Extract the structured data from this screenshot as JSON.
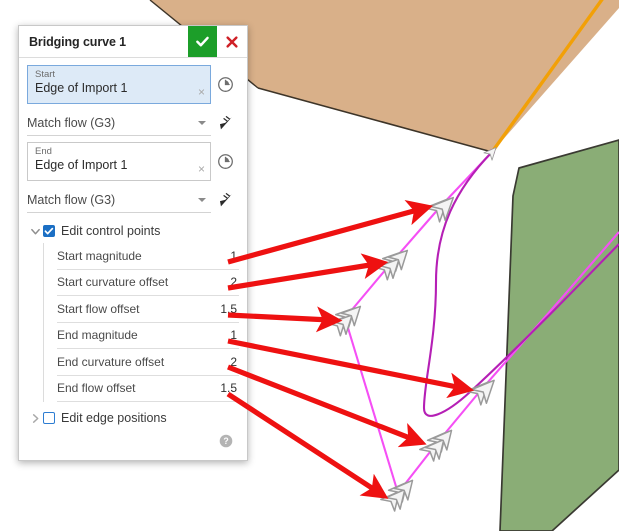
{
  "panel": {
    "title": "Bridging curve 1",
    "confirm_icon": "check-icon",
    "cancel_icon": "close-icon",
    "start": {
      "label": "Start",
      "value": "Edge of Import 1",
      "clear_icon": "×",
      "history_icon": "clock-icon",
      "continuity": "Match flow (G3)",
      "flow_icon": "flow-direction-arrow-icon"
    },
    "end": {
      "label": "End",
      "value": "Edge of Import 1",
      "clear_icon": "×",
      "history_icon": "clock-icon",
      "continuity": "Match flow (G3)",
      "flow_icon": "flow-direction-arrow-icon"
    },
    "edit_control_points": {
      "label": "Edit control points",
      "checked": true,
      "expanded": true,
      "chevron": "∨",
      "parameters": [
        {
          "name": "Start magnitude",
          "value": "1"
        },
        {
          "name": "Start curvature offset",
          "value": "2"
        },
        {
          "name": "Start flow offset",
          "value": "1.5"
        },
        {
          "name": "End magnitude",
          "value": "1"
        },
        {
          "name": "End curvature offset",
          "value": "2"
        },
        {
          "name": "End flow offset",
          "value": "1.5"
        }
      ]
    },
    "edit_edge_positions": {
      "label": "Edit edge positions",
      "checked": false,
      "expanded": false,
      "chevron": "›"
    },
    "help_icon": "help-circle-icon"
  },
  "viewport": {
    "surfaces": [
      {
        "name": "tan-surface",
        "fill": "#d9b089",
        "stroke": "#3d3428"
      },
      {
        "name": "green-surface",
        "fill": "#8aad76",
        "stroke": "#3a3a32"
      }
    ],
    "highlighted_edge_color": "#f2a007",
    "bridging_curve_color": "#b51fb5",
    "control_polygon_color": "#f54ff5",
    "control_point_color": "#ef2ad0",
    "handle_glyph_color": "#9a9a9a",
    "annotation_arrow_color": "#ee1111"
  },
  "colors": {
    "accent_blue": "#1b6fc4",
    "confirm_green": "#1c9e29",
    "cancel_red": "#cf2026"
  }
}
